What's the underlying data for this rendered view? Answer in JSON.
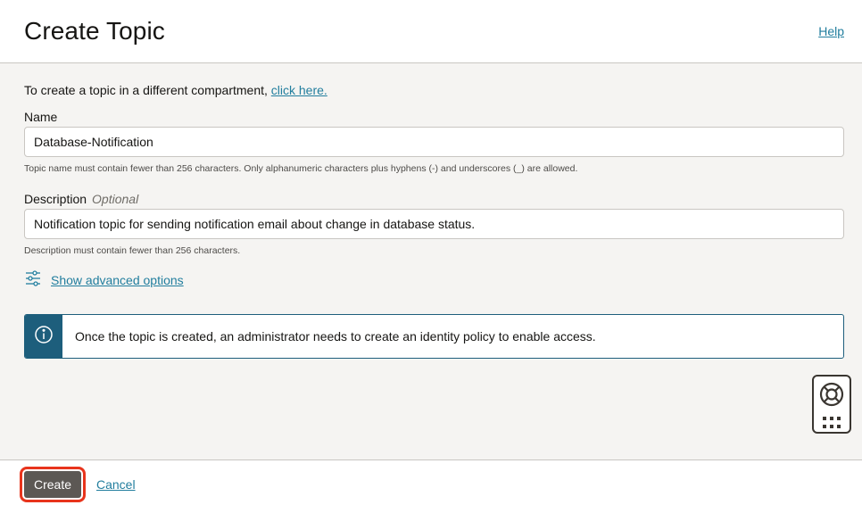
{
  "header": {
    "title": "Create Topic",
    "help_label": "Help"
  },
  "form": {
    "intro_text": "To create a topic in a different compartment,",
    "intro_link": "click here.",
    "name": {
      "label": "Name",
      "value": "Database-Notification",
      "hint": "Topic name must contain fewer than 256 characters. Only alphanumeric characters plus hyphens (-) and underscores (_) are allowed."
    },
    "description": {
      "label": "Description",
      "optional": "Optional",
      "value": "Notification topic for sending notification email about change in database status.",
      "hint": "Description must contain fewer than 256 characters."
    },
    "advanced_label": "Show advanced options",
    "info_message": "Once the topic is created, an administrator needs to create an identity policy to enable access."
  },
  "footer": {
    "create_label": "Create",
    "cancel_label": "Cancel"
  },
  "colors": {
    "link": "#227e9e",
    "info_accent": "#1d5e7c",
    "primary_button": "#5c5854",
    "highlight_outline": "#e8341c"
  },
  "icons": {
    "advanced": "sliders-icon",
    "info": "info-icon",
    "help_widget_top": "lifebuoy-icon",
    "help_widget_bottom": "grid-dots-icon"
  }
}
